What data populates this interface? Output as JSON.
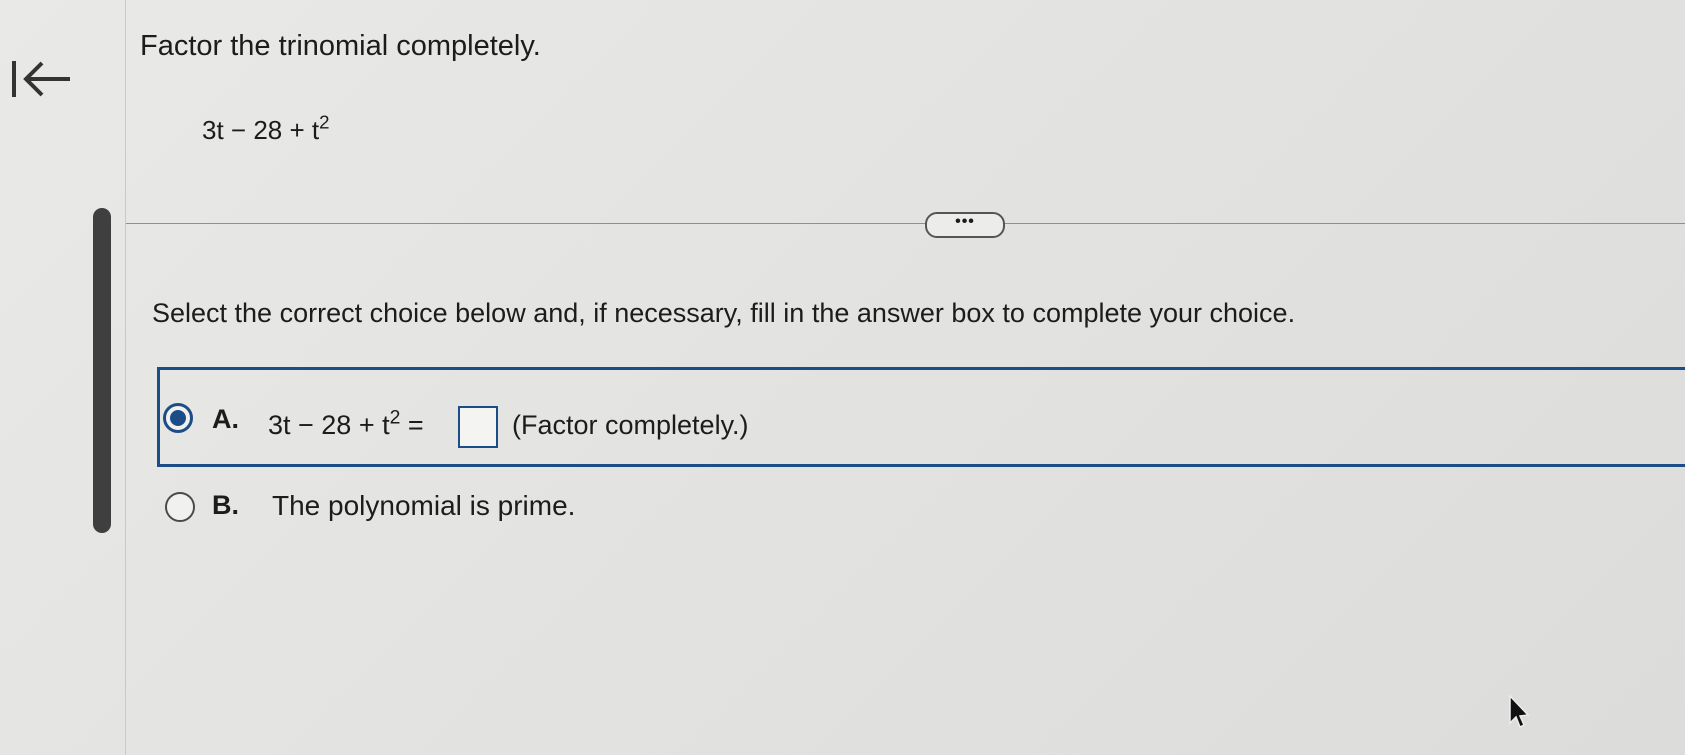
{
  "question": {
    "prompt": "Factor the trinomial completely.",
    "expression": {
      "base": "3t − 28 + t",
      "exponent": "2"
    }
  },
  "more_button_label": "•••",
  "instruction": "Select the correct choice below and, if necessary, fill in the answer box to complete your choice.",
  "choices": {
    "a": {
      "letter": "A.",
      "expression_base": "3t − 28 + t",
      "expression_exponent": "2",
      "equals": " =",
      "answer_value": "",
      "note": "(Factor completely.)",
      "selected": true
    },
    "b": {
      "letter": "B.",
      "text": "The polynomial is prime.",
      "selected": false
    }
  },
  "colors": {
    "accent": "#1d4d86",
    "background": "#e6e6e4",
    "text": "#1c1c1c"
  }
}
